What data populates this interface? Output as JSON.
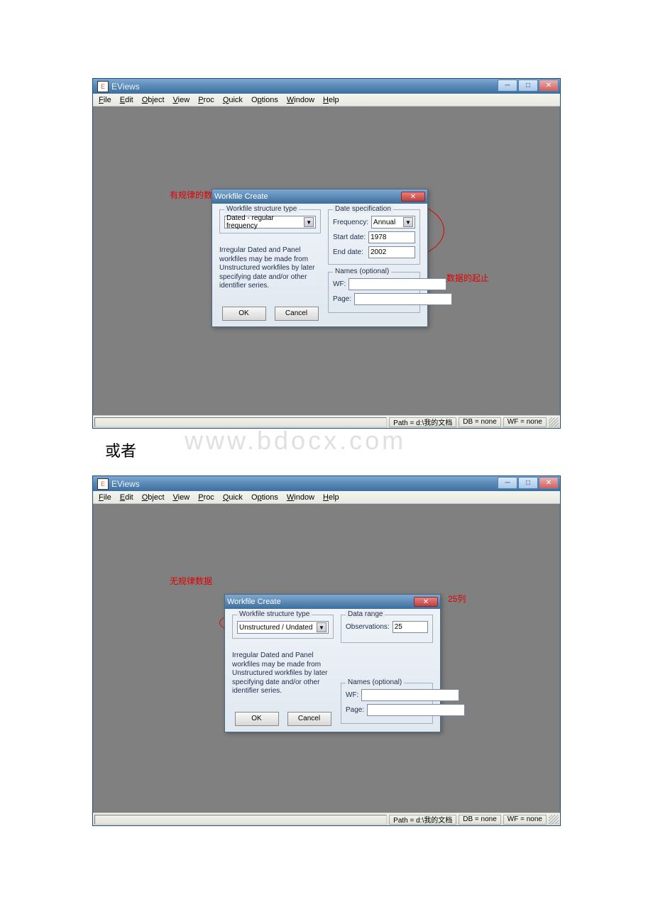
{
  "app": {
    "title": "EViews",
    "menu": {
      "file": "File",
      "edit": "Edit",
      "object": "Object",
      "view": "View",
      "proc": "Proc",
      "quick": "Quick",
      "options": "Options",
      "window": "Window",
      "help": "Help"
    }
  },
  "dialog1": {
    "title": "Workfile Create",
    "structure_legend": "Workfile structure type",
    "structure_value": "Dated - regular frequency",
    "desc": "Irregular Dated and Panel workfiles may be made from Unstructured workfiles by later specifying date and/or other identifier series.",
    "ok": "OK",
    "cancel": "Cancel",
    "date_legend": "Date specification",
    "freq_label": "Frequency:",
    "freq_value": "Annual",
    "start_label": "Start date:",
    "start_value": "1978",
    "end_label": "End date:",
    "end_value": "2002",
    "names_legend": "Names (optional)",
    "wf_label": "WF:",
    "page_label": "Page:"
  },
  "dialog2": {
    "title": "Workfile Create",
    "structure_legend": "Workfile structure type",
    "structure_value": "Unstructured / Undated",
    "desc": "Irregular Dated and Panel workfiles may be made from Unstructured workfiles by later specifying date and/or other identifier series.",
    "ok": "OK",
    "cancel": "Cancel",
    "range_legend": "Data range",
    "obs_label": "Observations:",
    "obs_value": "25",
    "names_legend": "Names (optional)",
    "wf_label": "WF:",
    "page_label": "Page:"
  },
  "status": {
    "path": "Path = d:\\我的文档",
    "db": "DB = none",
    "wf": "WF = none"
  },
  "annotations": {
    "a1": "有规律的数据",
    "a2": "数据的起止",
    "a3": "无规律数据",
    "a4": "25列"
  },
  "middle_text": "或者",
  "watermark": "www.bdocx.com"
}
